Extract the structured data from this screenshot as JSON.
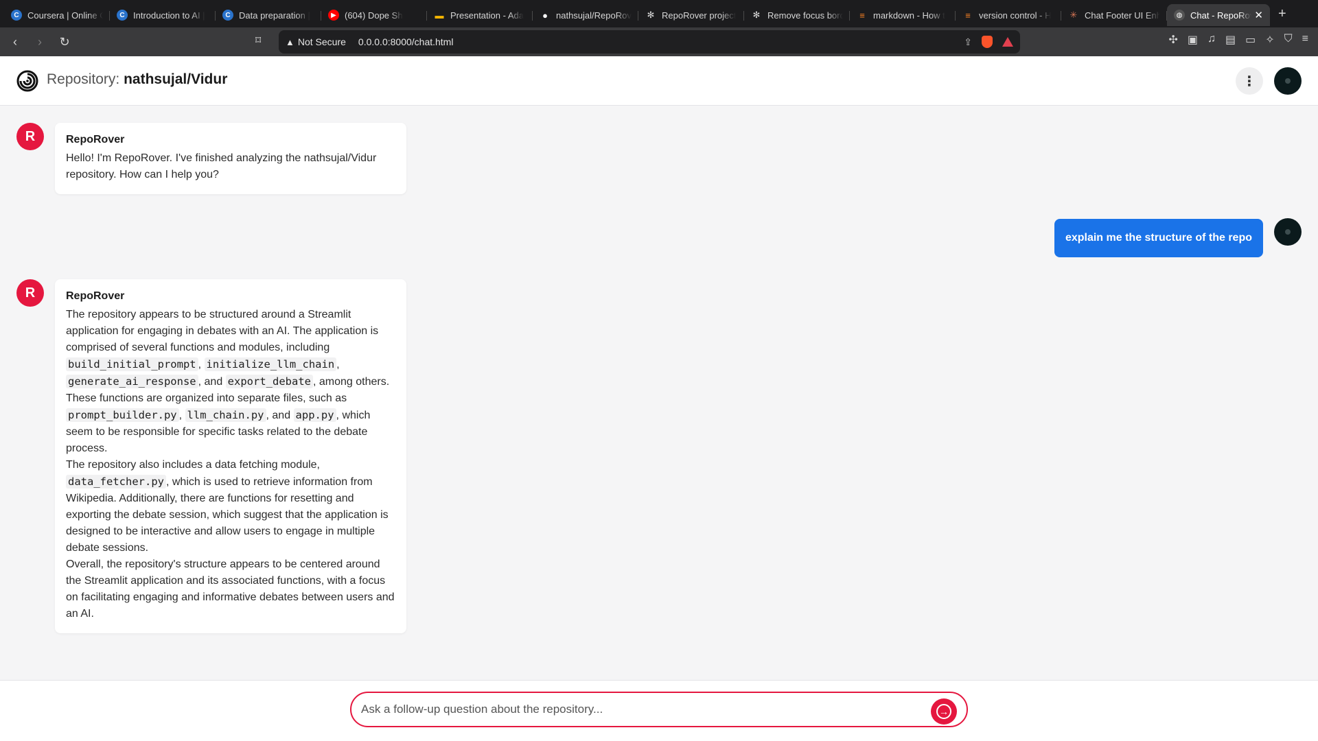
{
  "browser": {
    "tabs": [
      {
        "title": "Coursera | Online C",
        "icon": "coursera-icon",
        "color": "#2a73cc",
        "glyph": "C"
      },
      {
        "title": "Introduction to AI |",
        "icon": "coursera-icon",
        "color": "#2a73cc",
        "glyph": "C"
      },
      {
        "title": "Data preparation |",
        "icon": "coursera-icon",
        "color": "#2a73cc",
        "glyph": "C"
      },
      {
        "title": "(604) Dope Sh",
        "icon": "youtube-icon",
        "color": "#ff0000",
        "glyph": "▶"
      },
      {
        "title": "Presentation - Ada",
        "icon": "slides-icon",
        "color": "#f4b400",
        "glyph": "▬"
      },
      {
        "title": "nathsujal/RepoRov",
        "icon": "github-icon",
        "color": "#ffffff",
        "glyph": "●"
      },
      {
        "title": "RepoRover project",
        "icon": "openai-icon",
        "color": "#d6d6d6",
        "glyph": "✻"
      },
      {
        "title": "Remove focus bord",
        "icon": "openai-icon",
        "color": "#d6d6d6",
        "glyph": "✻"
      },
      {
        "title": "markdown - How t",
        "icon": "stackoverflow-icon",
        "color": "#f48024",
        "glyph": "≡"
      },
      {
        "title": "version control - H",
        "icon": "stackoverflow-icon",
        "color": "#f48024",
        "glyph": "≡"
      },
      {
        "title": "Chat Footer UI Enh",
        "icon": "claude-icon",
        "color": "#d97757",
        "glyph": "✳"
      }
    ],
    "active_tab": {
      "title": "Chat - RepoRover",
      "icon": "globe-icon"
    },
    "address": {
      "security": "Not Secure",
      "url": "0.0.0.0:8000/chat.html"
    }
  },
  "header": {
    "prefix": "Repository:",
    "repo": "nathsujal/Vidur"
  },
  "messages": [
    {
      "role": "bot",
      "avatar": "R",
      "name": "RepoRover",
      "text": "Hello! I'm RepoRover. I've finished analyzing the nathsujal/Vidur repository. How can I help you?"
    },
    {
      "role": "user",
      "text": "explain me the structure of the repo"
    },
    {
      "role": "bot",
      "avatar": "R",
      "name": "RepoRover",
      "p1": {
        "a": "The repository appears to be structured around a Streamlit application for engaging in debates with an AI. The application is comprised of several functions and modules, including ",
        "c1": "build_initial_prompt",
        "s1": ", ",
        "c2": "initialize_llm_chain",
        "s2": ", ",
        "c3": "generate_ai_response",
        "s3": ", and ",
        "c4": "export_debate",
        "s4": ", among others. These functions are organized into separate files, such as ",
        "c5": "prompt_builder.py",
        "s5": ", ",
        "c6": "llm_chain.py",
        "s6": ", and ",
        "c7": "app.py",
        "s7": ", which seem to be responsible for specific tasks related to the debate process."
      },
      "p2": {
        "a": "The repository also includes a data fetching module, ",
        "c1": "data_fetcher.py",
        "b": ", which is used to retrieve information from Wikipedia. Additionally, there are functions for resetting and exporting the debate session, which suggest that the application is designed to be interactive and allow users to engage in multiple debate sessions."
      },
      "p3": "Overall, the repository's structure appears to be centered around the Streamlit application and its associated functions, with a focus on facilitating engaging and informative debates between users and an AI."
    }
  ],
  "composer": {
    "placeholder": "Ask a follow-up question about the repository..."
  },
  "colors": {
    "accent": "#e5173f",
    "user_bubble": "#1a73e8"
  }
}
